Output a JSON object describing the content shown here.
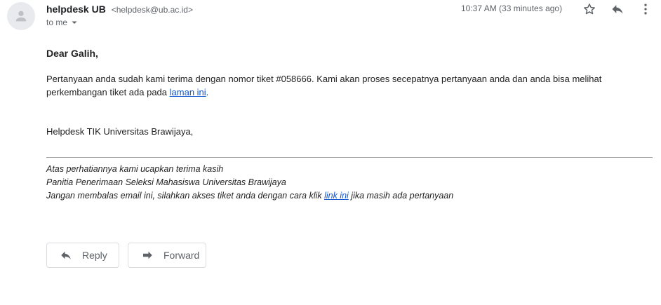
{
  "header": {
    "sender_name": "helpdesk UB",
    "sender_email": "<helpdesk@ub.ac.id>",
    "recipient_label": "to me",
    "timestamp": "10:37 AM (33 minutes ago)"
  },
  "icons": {
    "avatar": "person-icon",
    "star": "star-icon",
    "reply": "reply-icon",
    "more": "more-vert-icon",
    "caret": "caret-down-icon",
    "forward": "forward-icon"
  },
  "body": {
    "greeting": "Dear Galih,",
    "paragraph_text": "Pertanyaan anda sudah kami terima dengan nomor tiket #058666. Kami akan proses secepatnya pertanyaan anda dan anda bisa melihat perkembangan tiket ada pada ",
    "paragraph_link": "laman ini",
    "paragraph_end": ".",
    "signoff": "Helpdesk TIK Universitas Brawijaya,"
  },
  "footer": {
    "line1": "Atas perhatiannya kami ucapkan terima kasih",
    "line2": "Panitia Penerimaan Seleksi Mahasiswa Universitas Brawijaya",
    "line3_before": "Jangan membalas email ini, silahkan akses tiket anda dengan cara klik ",
    "line3_link": "link ini",
    "line3_after": " jika masih ada pertanyaan"
  },
  "actions": {
    "reply_label": "Reply",
    "forward_label": "Forward"
  },
  "colors": {
    "link": "#1155cc",
    "secondary_text": "#5f6368",
    "border": "#dadce0"
  }
}
